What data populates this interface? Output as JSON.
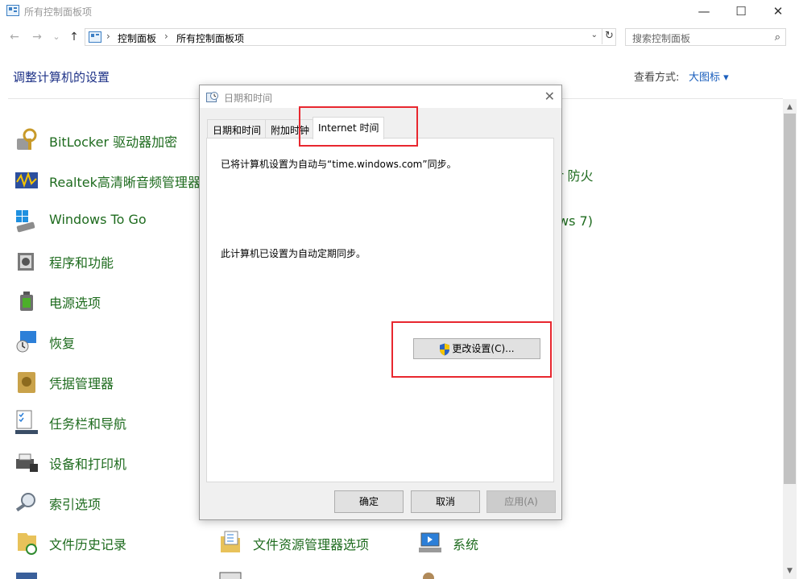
{
  "window": {
    "title": "所有控制面板项",
    "minimize": "—",
    "maximize": "☐",
    "close": "✕"
  },
  "nav": {
    "back": "←",
    "forward": "→",
    "history": "⌄",
    "up": "↑"
  },
  "address": {
    "crumbs": [
      "控制面板",
      "所有控制面板项"
    ],
    "separator": "›",
    "dropdown": "⌄",
    "refresh": "↻"
  },
  "search": {
    "placeholder": "搜索控制面板",
    "icon": "⌕"
  },
  "page": {
    "heading": "调整计算机的设置",
    "view_by_label": "查看方式:",
    "view_by_value": "大图标 ▾"
  },
  "items_col1": [
    {
      "label": "BitLocker 驱动器加密",
      "icon": "bitlocker-icon"
    },
    {
      "label": "Realtek高清晰音频管理器",
      "icon": "realtek-audio-icon"
    },
    {
      "label": "Windows To Go",
      "icon": "windows-to-go-icon"
    },
    {
      "label": "程序和功能",
      "icon": "programs-icon"
    },
    {
      "label": "电源选项",
      "icon": "power-icon"
    },
    {
      "label": "恢复",
      "icon": "recovery-icon"
    },
    {
      "label": "凭据管理器",
      "icon": "credential-icon"
    },
    {
      "label": "任务栏和导航",
      "icon": "taskbar-icon"
    },
    {
      "label": "设备和打印机",
      "icon": "printer-icon"
    },
    {
      "label": "索引选项",
      "icon": "index-icon"
    },
    {
      "label": "文件历史记录",
      "icon": "file-history-icon"
    }
  ],
  "items_col2": [
    {
      "label": "文件资源管理器选项",
      "icon": "explorer-options-icon"
    }
  ],
  "items_col3": [
    {
      "label": "系统",
      "icon": "system-icon"
    }
  ],
  "partials": {
    "firewall_fragment": "er 防火",
    "backup_fragment": "ws 7)"
  },
  "dialog": {
    "title": "日期和时间",
    "close": "✕",
    "tabs": [
      "日期和时间",
      "附加时钟",
      "Internet 时间"
    ],
    "active_tab": 2,
    "sync_text": "已将计算机设置为自动与“time.windows.com”同步。",
    "periodic_text": "此计算机已设置为自动定期同步。",
    "change_settings": "更改设置(C)...",
    "ok": "确定",
    "cancel": "取消",
    "apply": "应用(A)"
  },
  "colors": {
    "link_green": "#1e6b1e",
    "heading_blue": "#1e3287",
    "highlight_red": "#e8272f"
  }
}
